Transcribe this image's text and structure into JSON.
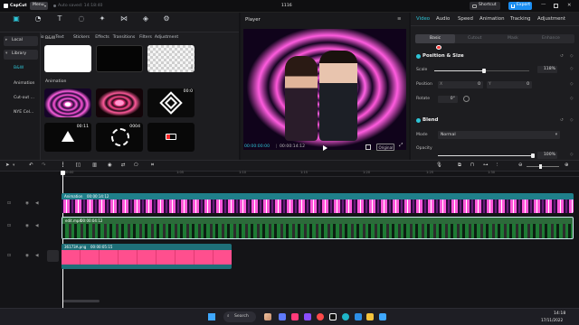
{
  "titlebar": {
    "app_name": "CapCut",
    "menu_label": "Menu",
    "autosave": "Auto saved: 14:18:40",
    "project_title": "1116",
    "shortcut_label": "Shortcut",
    "export_label": "Export"
  },
  "media_toolbar": {
    "tools": [
      {
        "label": "Media",
        "icon": "media-icon"
      },
      {
        "label": "Audio",
        "icon": "audio-icon"
      },
      {
        "label": "Text",
        "icon": "text-icon"
      },
      {
        "label": "Stickers",
        "icon": "stickers-icon"
      },
      {
        "label": "Effects",
        "icon": "effects-icon"
      },
      {
        "label": "Transitions",
        "icon": "transitions-icon"
      },
      {
        "label": "Filters",
        "icon": "filters-icon"
      },
      {
        "label": "Adjustment",
        "icon": "adjustment-icon"
      }
    ],
    "active": "Media"
  },
  "media_sidebar": {
    "items": [
      "Local",
      "Library",
      "B&W",
      "Animation",
      "Cut-out ...",
      "NYE Cel..."
    ]
  },
  "media_library": {
    "section_bw": "B&W",
    "section_animation": "Animation",
    "anim_thumbs": [
      {
        "time": ""
      },
      {
        "time": ""
      },
      {
        "time": "00:0"
      },
      {
        "time": "00:11"
      },
      {
        "time": "0004"
      },
      {
        "time": ""
      }
    ]
  },
  "player": {
    "title": "Player",
    "current_time": "00:00:00:00",
    "total_time": "00:00:14:12",
    "ratio_label": "Original"
  },
  "inspector": {
    "tabs": [
      "Video",
      "Audio",
      "Speed",
      "Animation",
      "Tracking",
      "Adjustment"
    ],
    "active_tab": "Video",
    "subtabs": [
      "Basic",
      "Cutout",
      "Mask",
      "Enhance"
    ],
    "position_size": {
      "title": "Position & Size",
      "scale_label": "Scale",
      "scale_value": "118%",
      "scale_fraction": 0.52,
      "position_label": "Position",
      "pos_x_axis": "X",
      "pos_x": "0",
      "pos_y_axis": "Y",
      "pos_y": "0",
      "rotate_label": "Rotate",
      "rotate_value": "0°"
    },
    "blend": {
      "title": "Blend",
      "mode_label": "Mode",
      "mode_value": "Normal",
      "opacity_label": "Opacity",
      "opacity_value": "100%",
      "opacity_fraction": 1.0
    }
  },
  "timeline": {
    "ruler_labels": [
      "00:00",
      "1:05",
      "1:10",
      "1:15",
      "1:20",
      "1:25",
      "1:30"
    ],
    "clips": [
      {
        "name": "Animation",
        "duration": "00:00:14:12",
        "color": "#1f7f8a"
      },
      {
        "name": "edit.mp4",
        "duration": "00:00:04:12",
        "color": "#2c6a3a"
      },
      {
        "name": "36173A.png",
        "duration": "00:00:05:15",
        "color": "#e23a72"
      }
    ]
  },
  "taskbar": {
    "search_label": "Search",
    "time": "14:18",
    "date": "17/11/2022"
  },
  "colors": {
    "accent": "#2ec4d6",
    "export": "#1b8ef2",
    "pink_clip": "#ff4f8e"
  }
}
